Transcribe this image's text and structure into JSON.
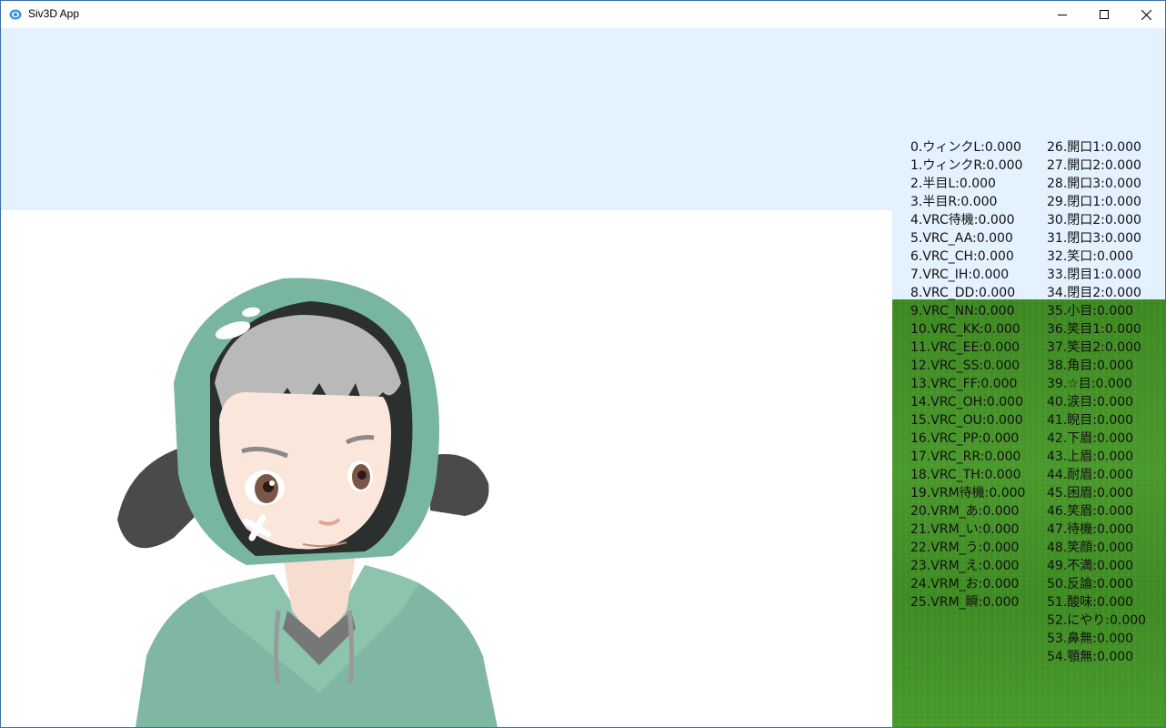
{
  "window": {
    "title": "Siv3D App",
    "icon": "siv3d-app-icon",
    "buttons": [
      "minimize-icon",
      "maximize-icon",
      "close-icon"
    ]
  },
  "colors": {
    "sky": "#e4f1fe",
    "ground": "#4a962b",
    "text": "#111111"
  },
  "morphs": {
    "left": [
      "0.ウィンクL:0.000",
      "1.ウィンクR:0.000",
      "2.半目L:0.000",
      "3.半目R:0.000",
      "4.VRC待機:0.000",
      "5.VRC_AA:0.000",
      "6.VRC_CH:0.000",
      "7.VRC_IH:0.000",
      "8.VRC_DD:0.000",
      "9.VRC_NN:0.000",
      "10.VRC_KK:0.000",
      "11.VRC_EE:0.000",
      "12.VRC_SS:0.000",
      "13.VRC_FF:0.000",
      "14.VRC_OH:0.000",
      "15.VRC_OU:0.000",
      "16.VRC_PP:0.000",
      "17.VRC_RR:0.000",
      "18.VRC_TH:0.000",
      "19.VRM待機:0.000",
      "20.VRM_あ:0.000",
      "21.VRM_い:0.000",
      "22.VRM_う:0.000",
      "23.VRM_え:0.000",
      "24.VRM_お:0.000",
      "25.VRM_瞬:0.000"
    ],
    "right": [
      "26.開口1:0.000",
      "27.開口2:0.000",
      "28.開口3:0.000",
      "29.閉口1:0.000",
      "30.閉口2:0.000",
      "31.閉口3:0.000",
      "32.笑口:0.000",
      "33.閉目1:0.000",
      "34.閉目2:0.000",
      "35.小目:0.000",
      "36.笑目1:0.000",
      "37.笑目2:0.000",
      "38.角目:0.000",
      "39.☆目:0.000",
      "40.涙目:0.000",
      "41.睨目:0.000",
      "42.下眉:0.000",
      "43.上眉:0.000",
      "44.耐眉:0.000",
      "45.困眉:0.000",
      "46.笑眉:0.000",
      "47.待機:0.000",
      "48.笑顔:0.000",
      "49.不満:0.000",
      "50.反論:0.000",
      "51.酸味:0.000",
      "52.にやり:0.000",
      "53.鼻無:0.000",
      "54.顎無:0.000"
    ]
  }
}
